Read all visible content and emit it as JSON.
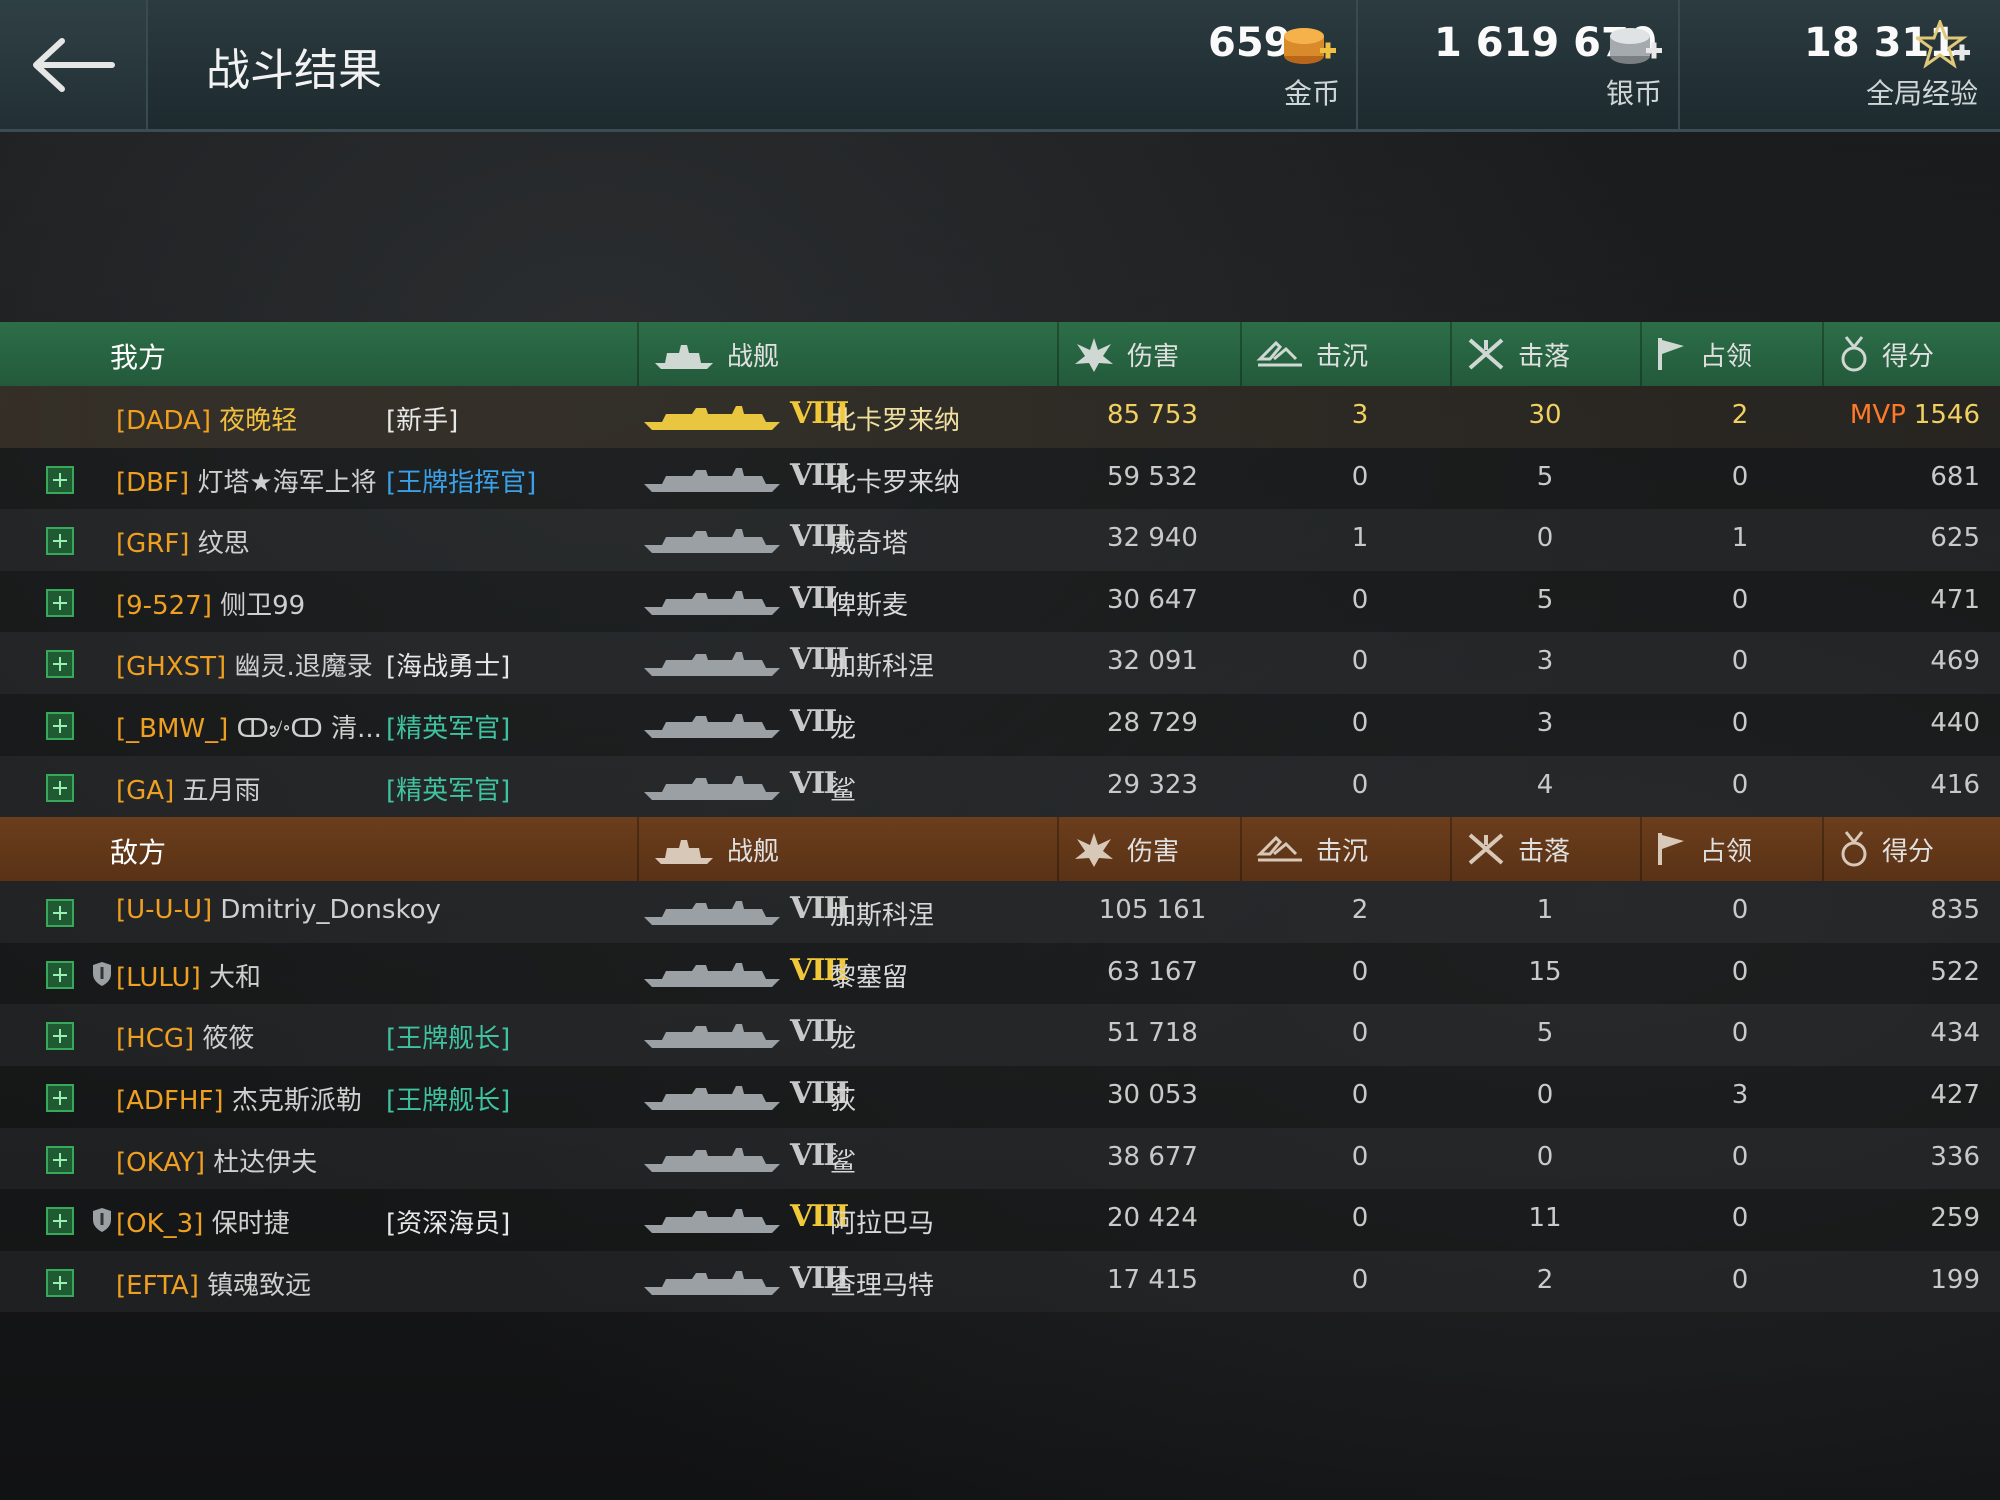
{
  "header": {
    "title": "战斗结果",
    "gold": {
      "value": "659",
      "label": "金币",
      "icon": "gold-coins-icon"
    },
    "silver": {
      "value": "1 619 670",
      "label": "银币",
      "icon": "silver-coins-icon"
    },
    "xp": {
      "value": "18 311",
      "label": "全局经验",
      "icon": "star-xp-icon"
    }
  },
  "columns": {
    "ship": "战舰",
    "damage": "伤害",
    "sunk": "击沉",
    "planes": "击落",
    "capture": "占领",
    "score": "得分"
  },
  "ally": {
    "label": "我方",
    "rows": [
      {
        "clan": "[DADA]",
        "name": "夜晚轻",
        "rank": "[新手]",
        "rank_color": "white",
        "tier": "VIII",
        "tier_gold": true,
        "ship": "北卡罗来纳",
        "damage": "85 753",
        "sunk": "3",
        "planes": "30",
        "capture": "2",
        "mvp": "MVP",
        "score": "1546",
        "highlight": true,
        "plus": false,
        "shield": false
      },
      {
        "clan": "[DBF]",
        "name": "灯塔★海军上将",
        "rank": "[王牌指挥官]",
        "rank_color": "blue",
        "tier": "VIII",
        "ship": "北卡罗来纳",
        "damage": "59 532",
        "sunk": "0",
        "planes": "5",
        "capture": "0",
        "score": "681",
        "plus": true
      },
      {
        "clan": "[GRF]",
        "name": "纹思",
        "rank": "",
        "tier": "VIII",
        "ship": "威奇塔",
        "damage": "32 940",
        "sunk": "1",
        "planes": "0",
        "capture": "1",
        "score": "625",
        "plus": true
      },
      {
        "clan": "[9-527]",
        "name": "侧卫99",
        "rank": "",
        "tier": "VII",
        "ship": "俾斯麦",
        "damage": "30 647",
        "sunk": "0",
        "planes": "5",
        "capture": "0",
        "score": "471",
        "plus": true
      },
      {
        "clan": "[GHXST]",
        "name": "幽灵.退魔录",
        "rank": "[海战勇士]",
        "rank_color": "white",
        "tier": "VIII",
        "ship": "加斯科涅",
        "damage": "32 091",
        "sunk": "0",
        "planes": "3",
        "capture": "0",
        "score": "469",
        "plus": true
      },
      {
        "clan": "[_BMW_]",
        "name": "ↀ৶৽ↀ 清...",
        "rank": "[精英军官]",
        "rank_color": "teal",
        "tier": "VII",
        "ship": "龙",
        "damage": "28 729",
        "sunk": "0",
        "planes": "3",
        "capture": "0",
        "score": "440",
        "plus": true
      },
      {
        "clan": "[GA]",
        "name": "五月雨",
        "rank": "[精英军官]",
        "rank_color": "teal",
        "tier": "VII",
        "ship": "鲨",
        "damage": "29 323",
        "sunk": "0",
        "planes": "4",
        "capture": "0",
        "score": "416",
        "plus": true
      }
    ]
  },
  "enemy": {
    "label": "敌方",
    "rows": [
      {
        "clan": "[U-U-U]",
        "name": "Dmitriy_Donskoy",
        "rank": "",
        "tier": "VIII",
        "ship": "加斯科涅",
        "damage": "105 161",
        "sunk": "2",
        "planes": "1",
        "capture": "0",
        "score": "835",
        "plus": true
      },
      {
        "clan": "[LULU]",
        "name": "大和",
        "rank": "",
        "tier": "VIII",
        "tier_gold": true,
        "ship": "黎塞留",
        "damage": "63 167",
        "sunk": "0",
        "planes": "15",
        "capture": "0",
        "score": "522",
        "plus": true,
        "shield": true
      },
      {
        "clan": "[HCG]",
        "name": "筱筱",
        "rank": "[王牌舰长]",
        "rank_color": "teal",
        "tier": "VII",
        "ship": "龙",
        "damage": "51 718",
        "sunk": "0",
        "planes": "5",
        "capture": "0",
        "score": "434",
        "plus": true
      },
      {
        "clan": "[ADFHF]",
        "name": "杰克斯派勒",
        "rank": "[王牌舰长]",
        "rank_color": "teal",
        "tier": "VIII",
        "ship": "荻",
        "damage": "30 053",
        "sunk": "0",
        "planes": "0",
        "capture": "3",
        "score": "427",
        "plus": true
      },
      {
        "clan": "[OKAY]",
        "name": "杜达伊夫",
        "rank": "",
        "tier": "VII",
        "ship": "鲨",
        "damage": "38 677",
        "sunk": "0",
        "planes": "0",
        "capture": "0",
        "score": "336",
        "plus": true
      },
      {
        "clan": "[OK_3]",
        "name": "保时捷",
        "rank": "[资深海员]",
        "rank_color": "white",
        "tier": "VIII",
        "tier_gold": true,
        "ship": "阿拉巴马",
        "damage": "20 424",
        "sunk": "0",
        "planes": "11",
        "capture": "0",
        "score": "259",
        "plus": true,
        "shield": true
      },
      {
        "clan": "[EFTA]",
        "name": "镇魂致远",
        "rank": "",
        "tier": "VIII",
        "ship": "查理马特",
        "damage": "17 415",
        "sunk": "0",
        "planes": "2",
        "capture": "0",
        "score": "199",
        "plus": true
      }
    ]
  }
}
